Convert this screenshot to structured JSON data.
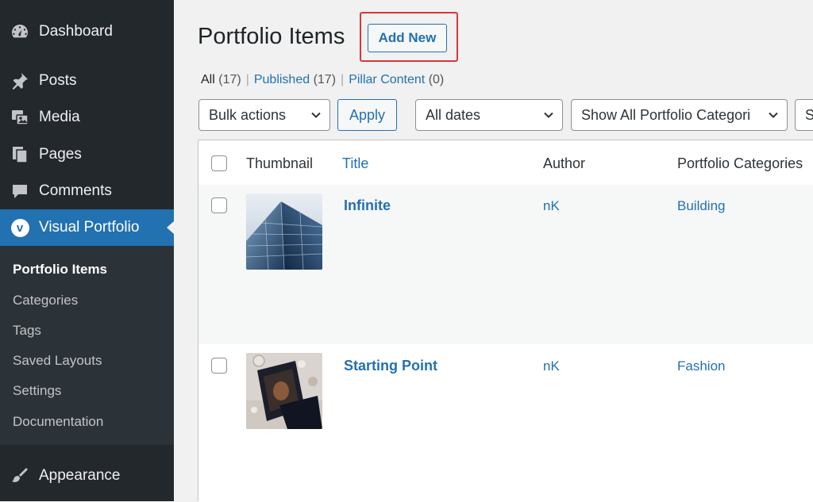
{
  "sidebar": {
    "items": [
      {
        "label": "Dashboard",
        "icon": "dashboard-icon"
      },
      {
        "label": "Posts",
        "icon": "pushpin-icon"
      },
      {
        "label": "Media",
        "icon": "media-icon"
      },
      {
        "label": "Pages",
        "icon": "pages-icon"
      },
      {
        "label": "Comments",
        "icon": "comment-icon"
      },
      {
        "label": "Visual Portfolio",
        "icon": "visual-portfolio-icon",
        "icon_text": "v"
      },
      {
        "label": "Appearance",
        "icon": "paintbrush-icon"
      }
    ],
    "submenu": [
      "Portfolio Items",
      "Categories",
      "Tags",
      "Saved Layouts",
      "Settings",
      "Documentation"
    ]
  },
  "page": {
    "title": "Portfolio Items",
    "add_new_label": "Add New"
  },
  "filters": {
    "all": {
      "label": "All",
      "count": "(17)"
    },
    "published": {
      "label": "Published",
      "count": "(17)"
    },
    "pillar": {
      "label": "Pillar Content",
      "count": "(0)"
    },
    "separator": "|"
  },
  "toolbar": {
    "bulk_actions": "Bulk actions",
    "apply": "Apply",
    "dates": "All dates",
    "categories": "Show All Portfolio Categori",
    "extra": "S"
  },
  "table": {
    "columns": [
      "Thumbnail",
      "Title",
      "Author",
      "Portfolio Categories"
    ],
    "rows": [
      {
        "title": "Infinite",
        "author": "nK",
        "category": "Building",
        "thumb": "building-thumbnail"
      },
      {
        "title": "Starting Point",
        "author": "nK",
        "category": "Fashion",
        "thumb": "fashion-thumbnail"
      }
    ]
  },
  "colors": {
    "sidebar_bg": "#23282d",
    "accent": "#2271b1",
    "highlight": "#d63638"
  }
}
